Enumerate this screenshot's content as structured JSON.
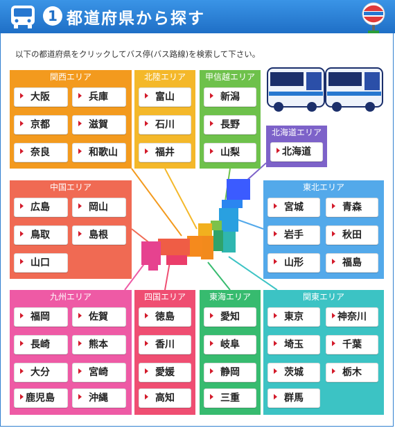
{
  "header": {
    "number": "1",
    "title": "都道府県から探す",
    "icons": [
      "bus-icon",
      "bus-stop-sign-icon"
    ]
  },
  "intro": "以下の都道府県をクリックしてバス停(バス路線)を検索して下さい。",
  "regions": {
    "kansai": {
      "title": "関西エリア",
      "prefs": [
        "大阪",
        "兵庫",
        "京都",
        "滋賀",
        "奈良",
        "和歌山"
      ]
    },
    "hokuriku": {
      "title": "北陸エリア",
      "prefs": [
        "富山",
        "石川",
        "福井"
      ]
    },
    "koshinetsu": {
      "title": "甲信越エリア",
      "prefs": [
        "新潟",
        "長野",
        "山梨"
      ]
    },
    "hokkaido": {
      "title": "北海道エリア",
      "prefs": [
        "北海道"
      ]
    },
    "chugoku": {
      "title": "中国エリア",
      "prefs": [
        "広島",
        "岡山",
        "鳥取",
        "島根",
        "山口"
      ]
    },
    "tohoku": {
      "title": "東北エリア",
      "prefs": [
        "宮城",
        "青森",
        "岩手",
        "秋田",
        "山形",
        "福島"
      ]
    },
    "kyushu": {
      "title": "九州エリア",
      "prefs": [
        "福岡",
        "佐賀",
        "長崎",
        "熊本",
        "大分",
        "宮崎",
        "鹿児島",
        "沖縄"
      ]
    },
    "shikoku": {
      "title": "四国エリア",
      "prefs": [
        "徳島",
        "香川",
        "愛媛",
        "高知"
      ]
    },
    "tokai": {
      "title": "東海エリア",
      "prefs": [
        "愛知",
        "岐阜",
        "静岡",
        "三重"
      ]
    },
    "kanto": {
      "title": "関東エリア",
      "prefs": [
        "東京",
        "神奈川",
        "埼玉",
        "千葉",
        "茨城",
        "栃木",
        "群馬"
      ]
    }
  },
  "colors": {
    "header": "#2677d0",
    "arrow": "#d31b2b",
    "kansai": "#f39a1e",
    "hokuriku": "#f4b82a",
    "koshinetsu": "#6ec14b",
    "hokkaido": "#7d62c9",
    "chugoku": "#f06a53",
    "tohoku": "#53a9ea",
    "kyushu": "#ee5aa5",
    "shikoku": "#ef4e72",
    "tokai": "#37bb6f",
    "kanto": "#3cc3c4"
  }
}
